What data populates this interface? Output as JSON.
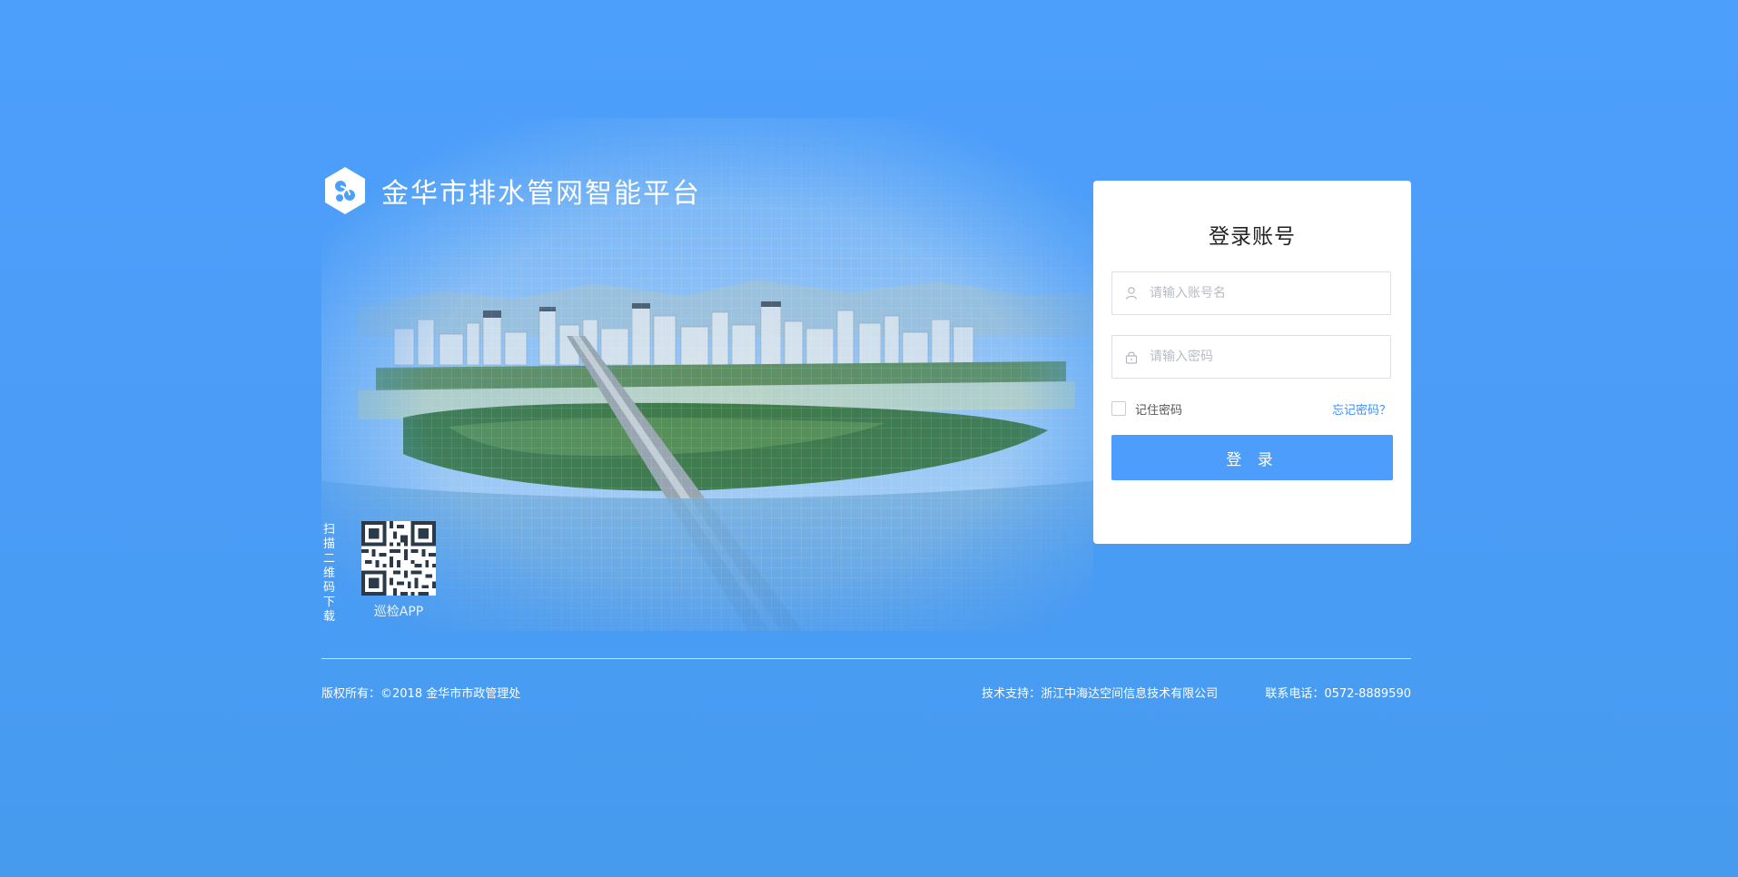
{
  "brand": {
    "title": "金华市排水管网智能平台",
    "logo_icon": "hexagon-logo-icon"
  },
  "qr": {
    "vertical_text": "扫描二维码下载",
    "caption": "巡检APP"
  },
  "login": {
    "title": "登录账号",
    "username_placeholder": "请输入账号名",
    "password_placeholder": "请输入密码",
    "remember_label": "记住密码",
    "forgot_link": "忘记密码？",
    "submit_label": "登 录",
    "username_icon": "user-icon",
    "password_icon": "lock-icon"
  },
  "footer": {
    "copyright": "版权所有：©2018 金华市市政管理处",
    "support": "技术支持：浙江中海达空间信息技术有限公司",
    "phone": "联系电话：0572-8889590"
  },
  "colors": {
    "background": "#4d9ffc",
    "primary_button": "#4c9dfc",
    "link": "#3e8ef7",
    "card": "#ffffff"
  }
}
